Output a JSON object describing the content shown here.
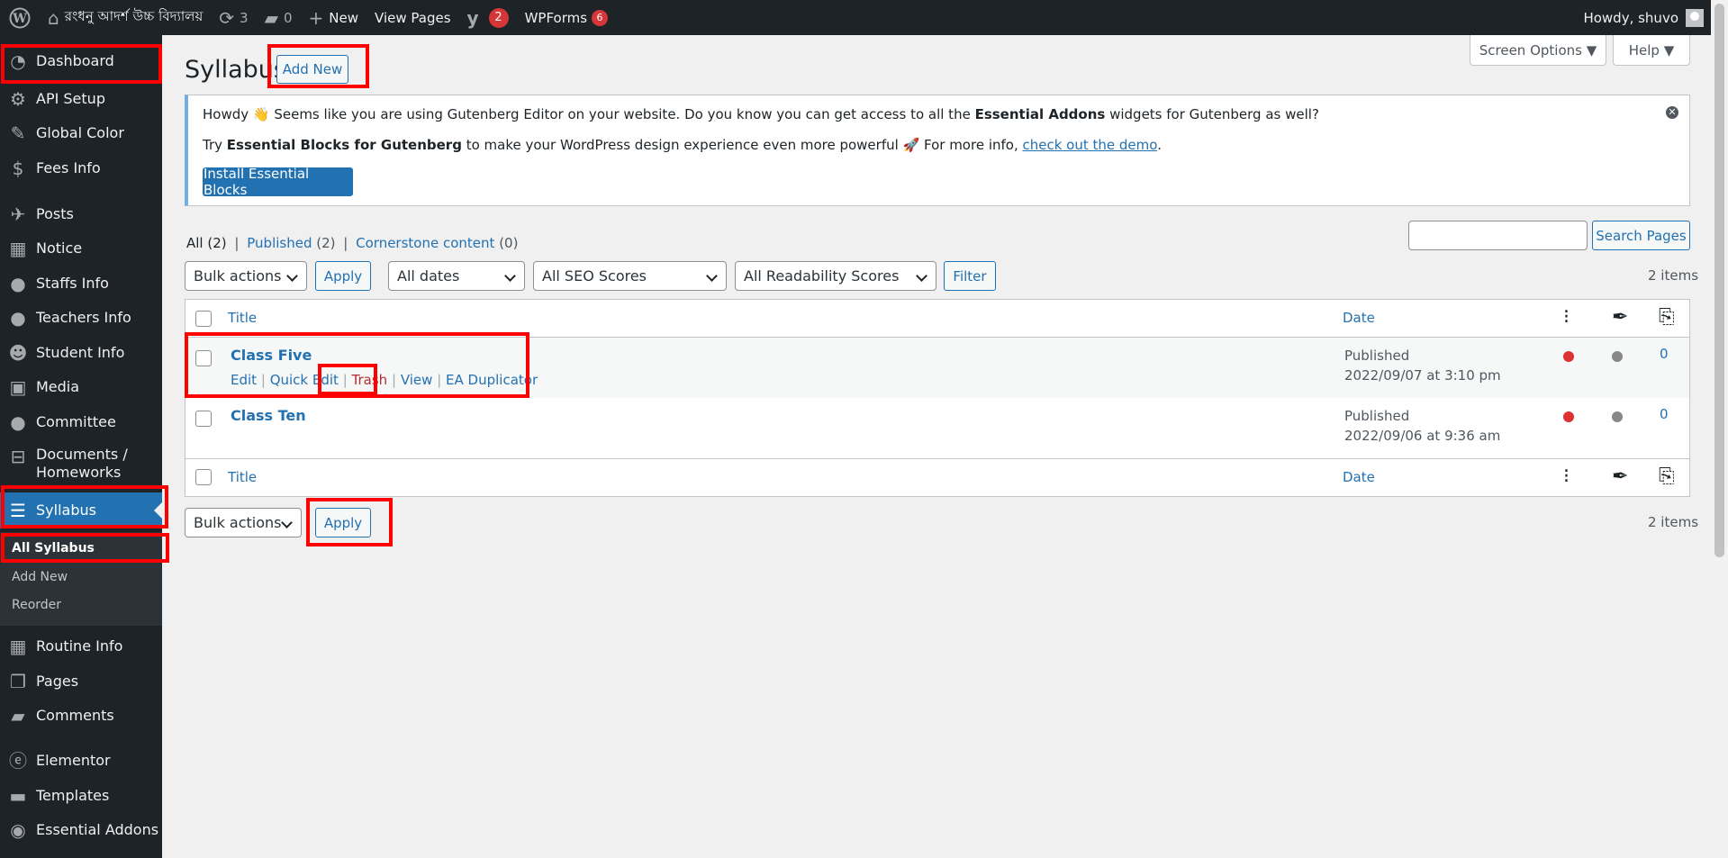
{
  "admin_bar": {
    "site_name": "রংধনু আদর্শ উচ্চ বিদ্যালয়",
    "updates_count": "3",
    "comments_count": "0",
    "new_label": "New",
    "view_pages_label": "View Pages",
    "yoast_count": "2",
    "wpforms_label": "WPForms",
    "wpforms_count": "6",
    "howdy": "Howdy, shuvo"
  },
  "sidebar": {
    "items": [
      {
        "label": "Dashboard",
        "icon": "dashboard-icon"
      },
      {
        "label": "API Setup",
        "icon": "api-icon"
      },
      {
        "label": "Global Color",
        "icon": "brush-icon"
      },
      {
        "label": "Fees Info",
        "icon": "dollar-icon"
      },
      {
        "label": "Posts",
        "icon": "pin-icon"
      },
      {
        "label": "Notice",
        "icon": "calendar-icon"
      },
      {
        "label": "Staffs Info",
        "icon": "user-icon"
      },
      {
        "label": "Teachers Info",
        "icon": "user-icon"
      },
      {
        "label": "Student Info",
        "icon": "groups-icon"
      },
      {
        "label": "Media",
        "icon": "media-icon"
      },
      {
        "label": "Committee",
        "icon": "user-icon"
      },
      {
        "label": "Documents / Homeworks",
        "icon": "document-icon"
      },
      {
        "label": "Syllabus",
        "icon": "list-icon"
      },
      {
        "label": "Routine Info",
        "icon": "calendar-icon"
      },
      {
        "label": "Pages",
        "icon": "pages-icon"
      },
      {
        "label": "Comments",
        "icon": "comment-icon"
      },
      {
        "label": "Elementor",
        "icon": "elementor-icon"
      },
      {
        "label": "Templates",
        "icon": "folder-icon"
      },
      {
        "label": "Essential Addons",
        "icon": "ea-icon"
      }
    ],
    "submenu": [
      "All Syllabus",
      "Add New",
      "Reorder"
    ]
  },
  "screen_options": "Screen Options ▼",
  "help": "Help ▼",
  "page": {
    "title": "Syllabus",
    "add_new": "Add New"
  },
  "notice": {
    "l1_a": "Howdy 👋 Seems like you are using Gutenberg Editor on your website. Do you know you can get access to all the ",
    "l1_b": "Essential Addons",
    "l1_c": " widgets for Gutenberg as well?",
    "l2_a": "Try ",
    "l2_b": "Essential Blocks for Gutenberg",
    "l2_c": " to make your WordPress design experience even more powerful 🚀 For more info, ",
    "l2_link": "check out the demo",
    "l2_d": ".",
    "button": "Install Essential Blocks",
    "dismiss": "✕"
  },
  "filters": {
    "all": "All",
    "all_count": "(2)",
    "sep": "|",
    "published": "Published",
    "published_count": "(2)",
    "cornerstone": "Cornerstone content",
    "cornerstone_count": "(0)"
  },
  "search_button": "Search Pages",
  "bulk_actions": "Bulk actions",
  "apply": "Apply",
  "all_dates": "All dates",
  "seo_scores": "All SEO Scores",
  "readability_scores": "All Readability Scores",
  "filter_button": "Filter",
  "items_count": "2 items",
  "table": {
    "col_title": "Title",
    "col_date": "Date",
    "rows": [
      {
        "title": "Class Five",
        "status": "Published",
        "date": "2022/09/07 at 3:10 pm",
        "links": "0",
        "actions": {
          "edit": "Edit",
          "quick_edit": "Quick Edit",
          "trash": "Trash",
          "view": "View",
          "duplicator": "EA Duplicator",
          "sep": "|"
        }
      },
      {
        "title": "Class Ten",
        "status": "Published",
        "date": "2022/09/06 at 9:36 am",
        "links": "0"
      }
    ]
  },
  "colors": {
    "accent": "#2271b1",
    "sidebar": "#1d2327",
    "highlight": "#ff0000",
    "seo_dot": "#dc3232"
  }
}
